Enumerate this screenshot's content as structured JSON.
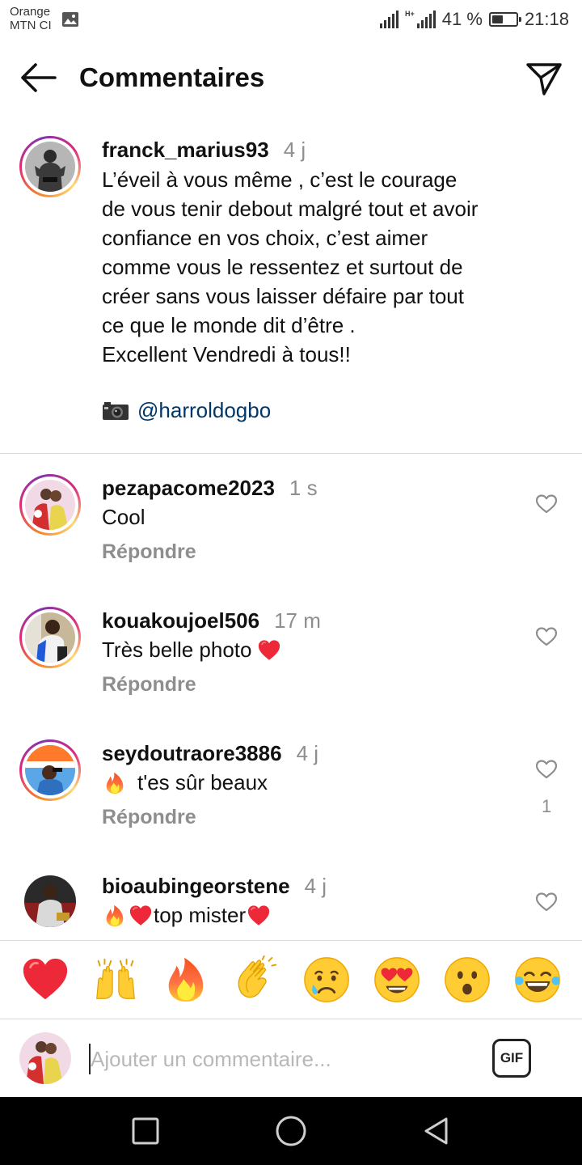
{
  "status_bar": {
    "carrier_line1": "Orange",
    "carrier_line2": "MTN CI",
    "battery_percent": "41 %",
    "time": "21:18",
    "network_type": "H+"
  },
  "header": {
    "title": "Commentaires",
    "back_icon": "arrow-left-icon",
    "share_icon": "paper-plane-icon"
  },
  "caption": {
    "username": "franck_marius93",
    "time": "4 j",
    "text": "L’éveil à vous même , c’est le courage\nde vous tenir debout malgré tout et avoir\nconfiance en vos choix, c’est aimer\ncomme vous le ressentez et surtout de\ncréer sans vous laisser défaire par tout\nce que le monde dit d’être .\nExcellent Vendredi à tous!!",
    "credit_icon": "camera-emoji",
    "mention": "@harroldogbo"
  },
  "comments": [
    {
      "username": "pezapacome2023",
      "time": "1 s",
      "text": "Cool",
      "emoji_before": "",
      "emoji_after": "",
      "reply_label": "Répondre",
      "likes": ""
    },
    {
      "username": "kouakoujoel506",
      "time": "17 m",
      "text": "Très belle photo",
      "emoji_before": "",
      "emoji_after": "heart-emoji",
      "reply_label": "Répondre",
      "likes": ""
    },
    {
      "username": "seydoutraore3886",
      "time": "4 j",
      "text": "t'es sûr beaux",
      "emoji_before": "fire-emoji",
      "emoji_after": "",
      "reply_label": "Répondre",
      "likes": "1"
    },
    {
      "username": "bioaubingeorstene",
      "time": "4 j",
      "text": "top mister",
      "emoji_before": "fire-emoji heart-emoji",
      "emoji_after": "heart-emoji",
      "reply_label": "",
      "likes": ""
    }
  ],
  "reactions": [
    "heart-emoji",
    "raising-hands-emoji",
    "fire-emoji",
    "clapping-hands-emoji",
    "crying-face-emoji",
    "heart-eyes-emoji",
    "surprised-face-emoji",
    "tears-of-joy-emoji"
  ],
  "composer": {
    "placeholder": "Ajouter un commentaire...",
    "gif_label": "GIF"
  },
  "nav": {
    "back_icon": "nav-back-icon",
    "home_icon": "nav-home-icon",
    "recent_icon": "nav-recent-apps-icon"
  },
  "colors": {
    "link": "#00376b",
    "secondary_text": "#8e8e8e",
    "heart": "#ed2939",
    "fire": "#f4511e"
  }
}
